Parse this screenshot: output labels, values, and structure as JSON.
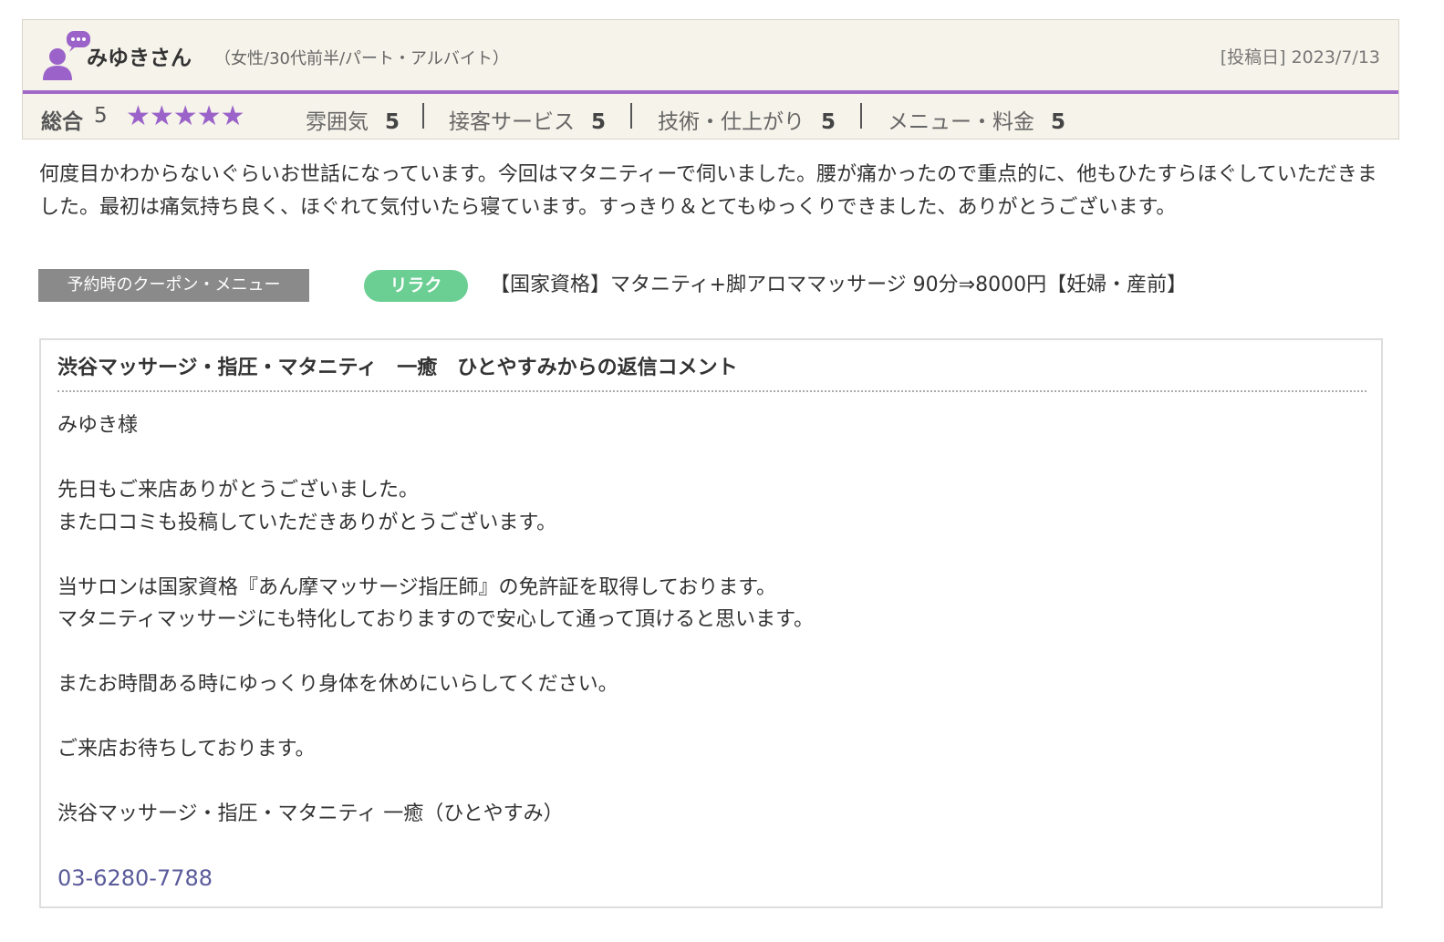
{
  "reviewer": {
    "name": "みゆきさん",
    "meta": "（女性/30代前半/パート・アルバイト）",
    "post_date": "[投稿日] 2023/7/13",
    "icon": "user-comment-icon"
  },
  "ratings": {
    "overall_label": "総合",
    "overall_value": "5",
    "stars": "★★★★★",
    "star_count": 5,
    "items": [
      {
        "label": "雰囲気",
        "value": "5"
      },
      {
        "label": "接客サービス",
        "value": "5"
      },
      {
        "label": "技術・仕上がり",
        "value": "5"
      },
      {
        "label": "メニュー・料金",
        "value": "5"
      }
    ]
  },
  "review_text": "何度目かわからないぐらいお世話になっています。今回はマタニティーで伺いました。腰が痛かったので重点的に、他もひたすらほぐしていただきました。最初は痛気持ち良く、ほぐれて気付いたら寝ています。すっきり＆とてもゆっくりできました、ありがとうございます。",
  "coupon": {
    "label": "予約時のクーポン・メニュー",
    "tag": "リラク",
    "menu": "【国家資格】マタニティ+脚アロママッサージ 90分⇒8000円【妊婦・産前】"
  },
  "reply": {
    "title": "渋谷マッサージ・指圧・マタニティ　一癒　ひとやすみからの返信コメント",
    "lines": [
      "みゆき様",
      "",
      "先日もご来店ありがとうございました。",
      "また口コミも投稿していただきありがとうございます。",
      "",
      "当サロンは国家資格『あん摩マッサージ指圧師』の免許証を取得しております。",
      "マタニティマッサージにも特化しておりますので安心して通って頂けると思います。",
      "",
      "またお時間ある時にゆっくり身体を休めにいらしてください。",
      "",
      "ご来店お待ちしております。",
      "",
      "渋谷マッサージ・指圧・マタニティ 一癒（ひとやすみ）"
    ],
    "phone": "03-6280-7788"
  },
  "colors": {
    "accent_purple": "#a169c7",
    "tag_green": "#6bcf93",
    "header_bg": "#f6f3ea"
  }
}
